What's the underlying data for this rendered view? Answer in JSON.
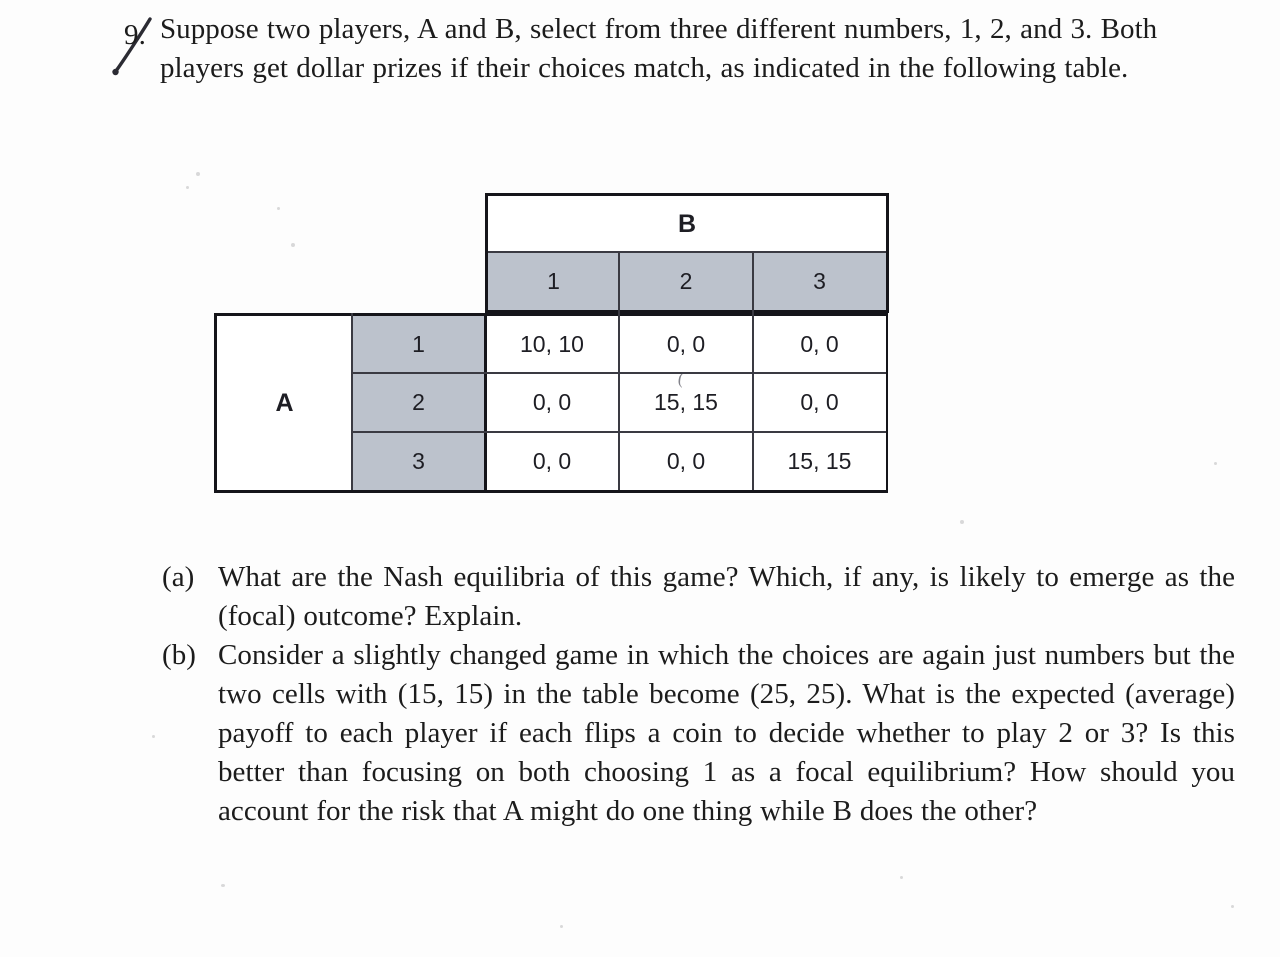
{
  "page": {
    "background_color": "#fdfdfd",
    "text_color": "#1c1c1c"
  },
  "question": {
    "number": "9.",
    "body": "Suppose two players, A and B, select from three different numbers, 1, 2, and 3. Both players get dollar prizes if their choices match, as indicated in the following table.",
    "handwriting_mark": "pen-slash"
  },
  "matrix": {
    "shade_color": "#bcc2cc",
    "border_color": "#15151a",
    "column_player_label": "B",
    "row_player_label": "A",
    "column_headers": [
      "1",
      "2",
      "3"
    ],
    "row_headers": [
      "1",
      "2",
      "3"
    ],
    "cells": [
      [
        "10, 10",
        "0, 0",
        "0, 0"
      ],
      [
        "0, 0",
        "15, 15",
        "0, 0"
      ],
      [
        "0, 0",
        "0, 0",
        "15, 15"
      ]
    ],
    "pencil_mark": "("
  },
  "subquestions": [
    {
      "marker": "(a)",
      "text": "What are the Nash equilibria of this game? Which, if any, is likely to emerge as the (focal) outcome? Explain."
    },
    {
      "marker": "(b)",
      "text": "Consider a slightly changed game in which the choices are again just numbers but the two cells with (15, 15) in the table become (25, 25). What is the expected (average) payoff to each player if each flips a coin to decide whether to play 2 or 3? Is this better than focusing on both choosing 1 as a focal equilibrium? How should you account for the risk that A might do one thing while B does the other?"
    }
  ]
}
